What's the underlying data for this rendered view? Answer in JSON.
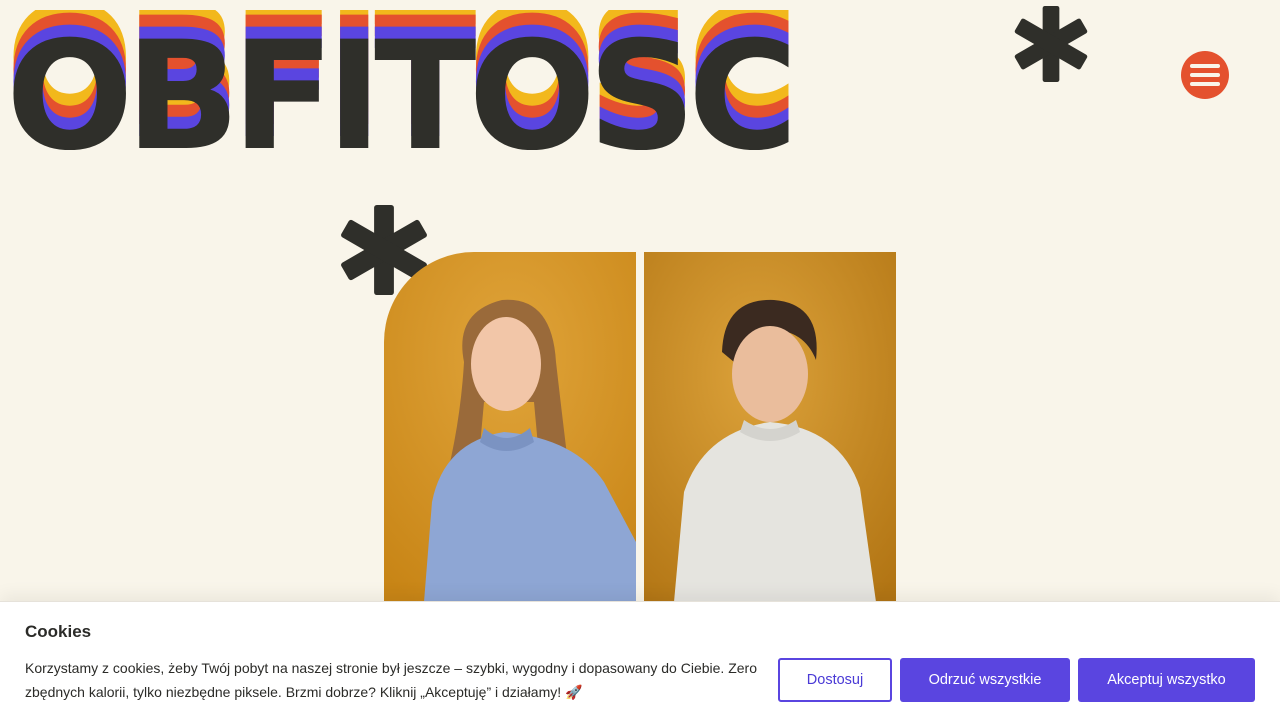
{
  "logo": {
    "text": "OBFITOSC"
  },
  "menu": {
    "icon": "hamburger-menu-icon"
  },
  "photos": [
    {
      "subject": "woman-in-blue-sweatshirt"
    },
    {
      "subject": "man-in-grey-sweatshirt"
    }
  ],
  "cookie_banner": {
    "title": "Cookies",
    "text": "Korzystamy z cookies, żeby Twój pobyt na naszej stronie był jeszcze – szybki, wygodny i dopasowany do Ciebie. Zero zbędnych kalorii, tylko niezbędne piksele. Brzmi dobrze? Kliknij „Akceptuję” i działamy! 🚀",
    "customize_label": "Dostosuj",
    "reject_label": "Odrzuć wszystkie",
    "accept_label": "Akceptuj wszystko"
  },
  "colors": {
    "background": "#f9f5ea",
    "ink": "#2f2f2a",
    "yellow": "#f2b81c",
    "orange": "#e4512e",
    "purple": "#5a45e0"
  }
}
